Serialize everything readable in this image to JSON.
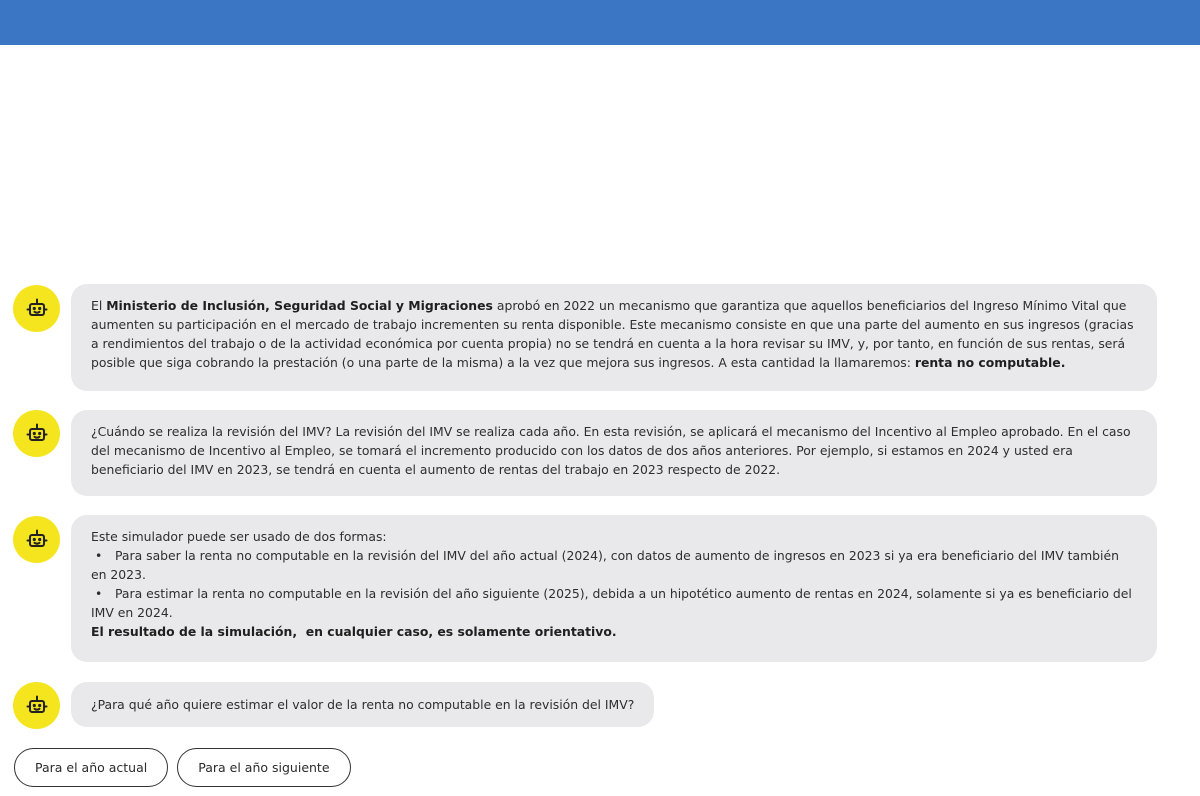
{
  "header": {
    "color": "#3b76c4"
  },
  "bot": {
    "icon": "robot-icon",
    "avatar_color": "#f5e51f"
  },
  "messages": [
    {
      "segments": [
        {
          "text": "El ",
          "bold": false
        },
        {
          "text": "Ministerio de Inclusión, Seguridad Social y Migraciones",
          "bold": true
        },
        {
          "text": " aprobó en 2022 un mecanismo que garantiza que aquellos beneficiarios del Ingreso Mínimo Vital que aumenten su participación en el mercado de trabajo incrementen su renta disponible. Este mecanismo consiste en que una parte del aumento en sus ingresos (gracias a rendimientos del trabajo o de la actividad económica por cuenta propia) no se tendrá en cuenta a la hora revisar su IMV, y, por tanto, en función de sus rentas, será posible que siga cobrando la prestación (o una parte de la misma) a la vez que mejora sus ingresos. A esta cantidad la llamaremos: ",
          "bold": false
        },
        {
          "text": "renta no computable.",
          "bold": true
        }
      ]
    },
    {
      "text": "¿Cuándo se realiza la revisión del IMV? La revisión del IMV se realiza cada año. En esta revisión, se aplicará el mecanismo del Incentivo al Empleo aprobado. En el caso del mecanismo de Incentivo al Empleo, se tomará el incremento producido con los datos de dos años anteriores. Por ejemplo, si estamos en 2024 y usted era beneficiario del IMV en 2023, se tendrá en cuenta el aumento de rentas del trabajo en 2023 respecto de 2022."
    },
    {
      "intro": "Este simulador puede ser usado de dos formas:",
      "bullets": [
        "Para saber la renta no computable en la revisión del IMV del año actual (2024), con datos de aumento de ingresos en 2023 si ya era beneficiario del IMV también en 2023.",
        "Para estimar la renta no computable en la revisión del año siguiente (2025), debida a un hipotético aumento de rentas en 2024, solamente si ya es beneficiario del IMV en 2024."
      ],
      "bullet_symbol": "•",
      "note": "El resultado de la simulación,  en cualquier caso, es solamente orientativo."
    },
    {
      "text": "¿Para qué año quiere estimar el valor de la renta no computable en la revisión del IMV?"
    }
  ],
  "options": [
    {
      "label": "Para el año actual"
    },
    {
      "label": "Para el año siguiente"
    }
  ]
}
